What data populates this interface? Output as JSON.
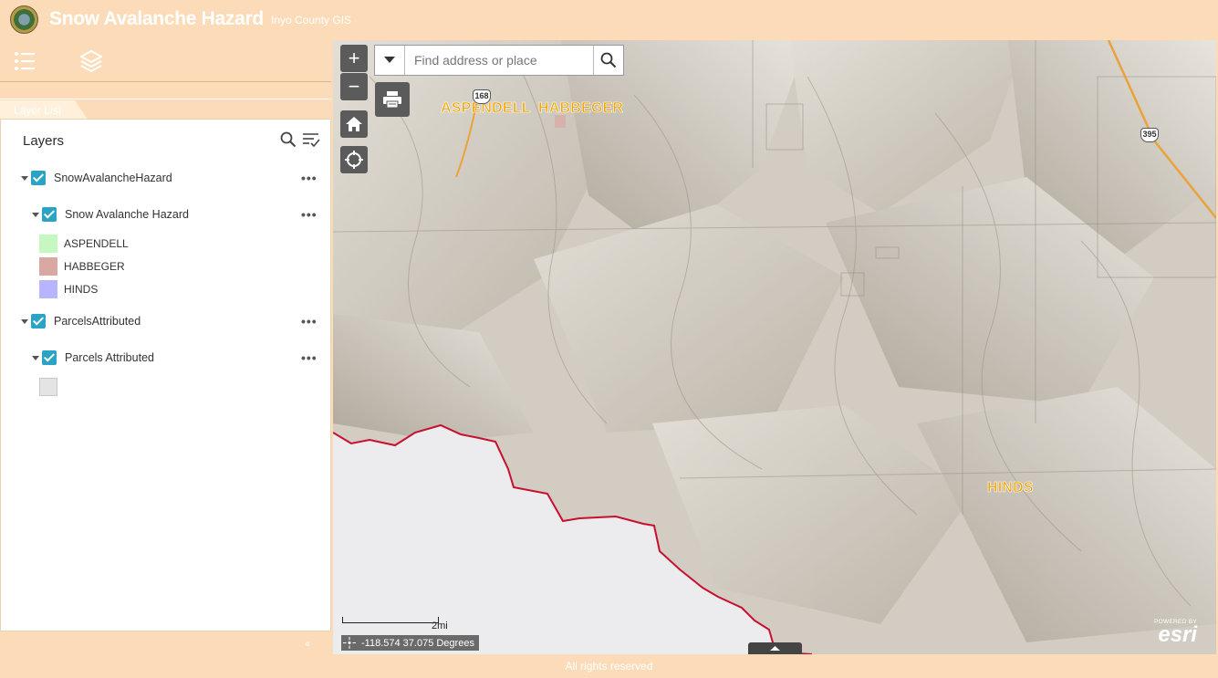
{
  "header": {
    "title": "Snow Avalanche Hazard",
    "subtitle": "Inyo County GIS"
  },
  "toolbar": {
    "items": [
      "layer-list-icon",
      "layers-icon"
    ]
  },
  "panel": {
    "tab_label": "Layer List",
    "heading": "Layers",
    "layers": [
      {
        "label": "SnowAvalancheHazard",
        "checked": true
      },
      {
        "label": "Snow Avalanche Hazard",
        "checked": true
      },
      {
        "label": "ParcelsAttributed",
        "checked": true
      },
      {
        "label": "Parcels Attributed",
        "checked": true
      }
    ],
    "legend": [
      {
        "label": "ASPENDELL",
        "color": "#c6f7c1"
      },
      {
        "label": "HABBEGER",
        "color": "#d9a8a3"
      },
      {
        "label": "HINDS",
        "color": "#b8b5ff"
      },
      {
        "label": "",
        "color": "#e4e4e4"
      }
    ],
    "more_glyph": "•••",
    "collapse_glyph": "«"
  },
  "map": {
    "search_placeholder": "Find address or place",
    "zoom_in": "+",
    "zoom_out": "−",
    "labels": {
      "aspendell": "ASPENDELL",
      "habbeger": "HABBEGER",
      "hinds": "HINDS"
    },
    "shields": {
      "hwy168": "168",
      "us395": "395"
    },
    "scale_label": "2mi",
    "coordinates": "-118.574 37.075 Degrees",
    "esri_powered": "POWERED BY",
    "esri_name": "esri"
  },
  "footer": {
    "text": "All rights reserved"
  },
  "colors": {
    "accent": "#fcdcb8",
    "checkbox": "#2aa3c4",
    "boundary": "#c8102e",
    "road": "#e8a33a"
  }
}
